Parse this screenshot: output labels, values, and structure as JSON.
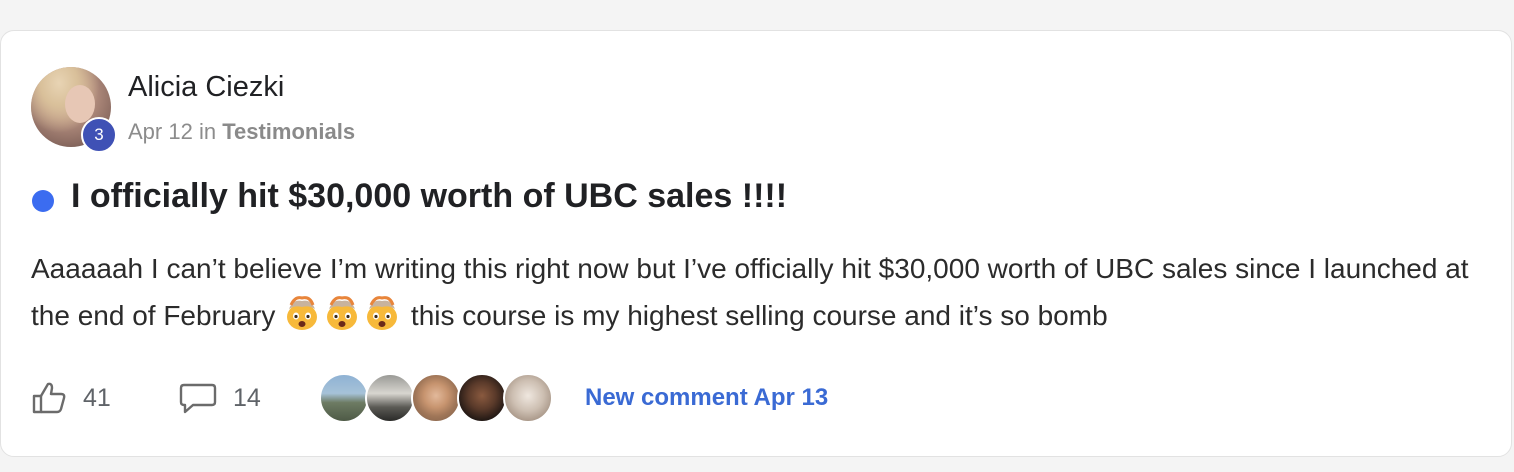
{
  "post": {
    "author": {
      "name": "Alicia Ciezki",
      "level": "3"
    },
    "date": "Apr 12",
    "in_label": "in",
    "category": "Testimonials",
    "title": "I officially hit $30,000 worth of UBC sales !!!!",
    "body_part1": "Aaaaaah I can’t believe I’m writing this right now but I’ve officially hit $30,000 worth of UBC sales since I launched at the end of February",
    "body_part2": " this course is my highest selling course and it’s so bomb",
    "emojis": [
      "exploding-head-emoji",
      "exploding-head-emoji",
      "exploding-head-emoji"
    ],
    "likes": "41",
    "comments": "14",
    "commenter_avatar_count": 5,
    "new_comment_label": "New comment Apr 13",
    "colors": {
      "unread_dot": "#3b6cf0",
      "level_badge": "#3f51b5",
      "link": "#3a6ad4"
    }
  }
}
